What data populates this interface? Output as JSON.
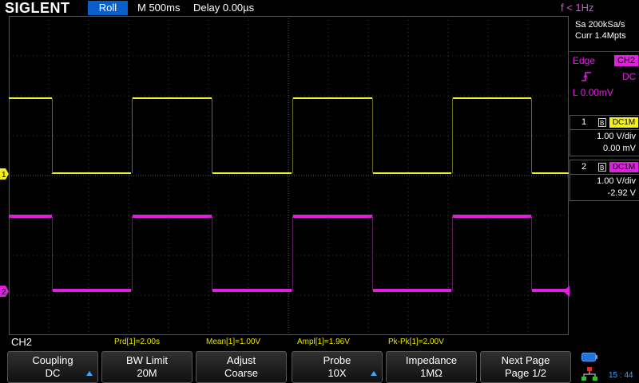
{
  "topbar": {
    "logo": "SIGLENT",
    "run_mode": "Roll",
    "timebase": "M 500ms",
    "delay": "Delay 0.00µs",
    "frequency": "f < 1Hz"
  },
  "acquisition": {
    "sample_rate": "Sa 200kSa/s",
    "memory": "Curr 1.4Mpts"
  },
  "trigger": {
    "type": "Edge",
    "source": "CH2",
    "coupling": "DC",
    "level": "L  0.00mV"
  },
  "channels": [
    {
      "number": "1",
      "coupling": "DC1M",
      "scale": "1.00 V/div",
      "offset": "0.00 mV",
      "color": "#f0f020"
    },
    {
      "number": "2",
      "coupling": "DC1M",
      "scale": "1.00 V/div",
      "offset": "-2.92 V",
      "color": "#e020e0"
    }
  ],
  "selected_channel": "CH2",
  "measurements": [
    {
      "label": "Prd[1]=2.00s"
    },
    {
      "label": "Mean[1]=1.00V"
    },
    {
      "label": "Ampl[1]=1.96V"
    },
    {
      "label": "Pk-Pk[1]=2.00V"
    }
  ],
  "softkeys": [
    {
      "line1": "Coupling",
      "line2": "DC",
      "has_arrow": true
    },
    {
      "line1": "BW Limit",
      "line2": "20M",
      "has_arrow": false
    },
    {
      "line1": "Adjust",
      "line2": "Coarse",
      "has_arrow": false
    },
    {
      "line1": "Probe",
      "line2": "10X",
      "has_arrow": true
    },
    {
      "line1": "Impedance",
      "line2": "1MΩ",
      "has_arrow": false
    },
    {
      "line1": "Next Page",
      "line2": "Page 1/2",
      "has_arrow": false
    }
  ],
  "clock": "15 : 44",
  "colors": {
    "ch1": "#f0f020",
    "ch2": "#e020e0",
    "accent": "#0a5ec9",
    "trigger_marker": "#3fa9ff"
  }
}
